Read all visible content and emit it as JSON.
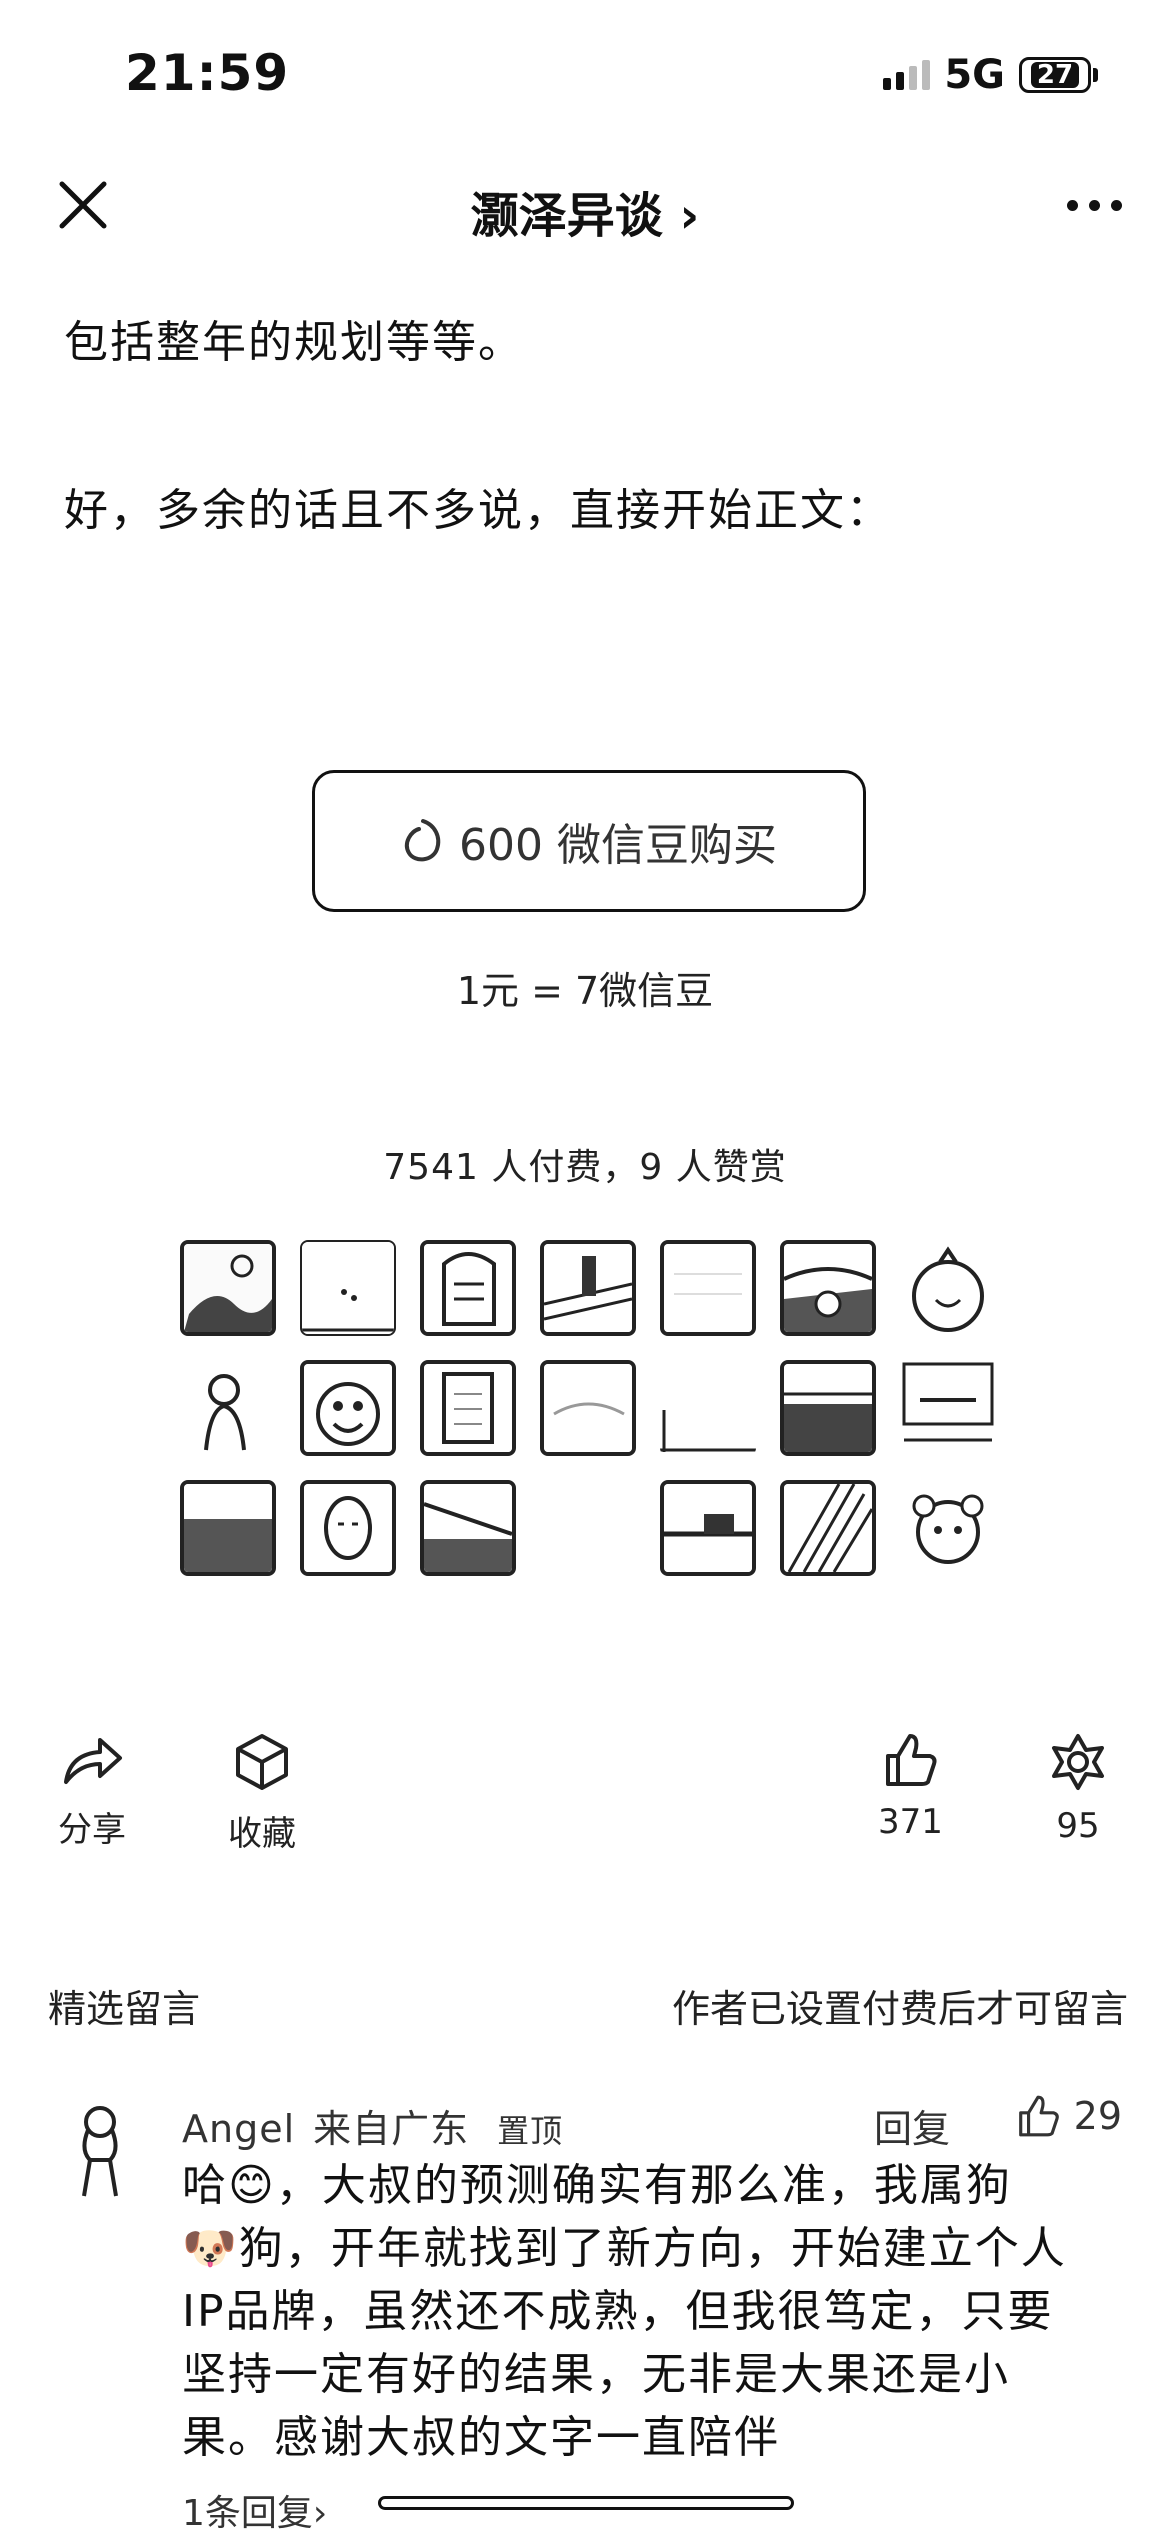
{
  "status_bar": {
    "time": "21:59",
    "network": "5G",
    "battery": "27"
  },
  "nav": {
    "title": "灏泽异谈 ›"
  },
  "article": {
    "line1": "包括整年的规划等等。",
    "line2": "好，多余的话且不多说，直接开始正文："
  },
  "purchase": {
    "button_label": "600 微信豆购买",
    "rate": "1元 = 7微信豆",
    "payers": "7541 人付费，9 人赞赏"
  },
  "avatars_count": 21,
  "actions": {
    "share": "分享",
    "favorite": "收藏",
    "like_count": "371",
    "wow_count": "95"
  },
  "comments_section": {
    "title": "精选留言",
    "notice": "作者已设置付费后才可留言"
  },
  "comment": {
    "author": "Angel",
    "location": "来自广东",
    "pinned": "置顶",
    "reply_label": "回复",
    "likes": "29",
    "lines": [
      "哈😊，大叔的预测确实有那么准，我属狗",
      "🐶狗，开年就找到了新方向，开始建立个人",
      "IP品牌，虽然还不成熟，但我很笃定，只要",
      "坚持一定有好的结果，无非是大果还是小",
      "果。感谢大叔的文字一直陪伴"
    ],
    "replies_link": "1条回复›"
  }
}
